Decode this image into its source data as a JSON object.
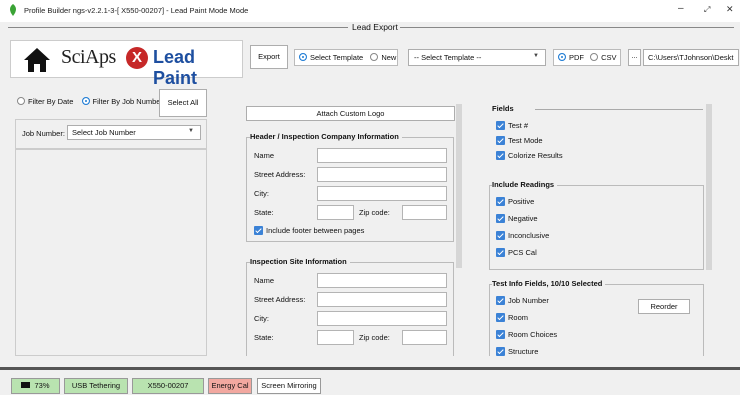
{
  "window": {
    "title": "Profile Builder ngs-v2.2.1-3-[ X550-00207] - Lead Paint Mode Mode",
    "minimize": "–",
    "restore": "⤢",
    "close": "✕"
  },
  "group_title": "Lead Export",
  "brand": {
    "sci": "SciAps",
    "x": "X",
    "product": "Lead Paint"
  },
  "toolbar": {
    "export_label": "Export",
    "select_template_label": "Select Template",
    "new_label": "New",
    "template_dropdown": "-- Select Template --",
    "pdf_label": "PDF",
    "csv_label": "CSV",
    "browse_label": "...",
    "path": "C:\\Users\\TJohnson\\Deskt"
  },
  "left": {
    "filter_by_date": "Filter By Date",
    "filter_by_job": "Filter By Job Number",
    "select_all": "Select All",
    "job_number_label": "Job Number:",
    "job_number_placeholder": "Select Job Number"
  },
  "middle": {
    "attach_logo": "Attach Custom Logo",
    "header_section": "Header / Inspection Company Information",
    "name": "Name",
    "street": "Street Address:",
    "city": "City:",
    "state": "State:",
    "zip": "Zip code:",
    "include_footer": "Include footer between pages",
    "site_section": "Inspection Site Information",
    "site_name": "Name",
    "site_street": "Street Address:",
    "site_city": "City:",
    "site_state": "State:",
    "site_zip": "Zip code:"
  },
  "right": {
    "fields_title": "Fields",
    "fields": [
      "Test #",
      "Test Mode",
      "Colorize Results"
    ],
    "readings_title": "Include Readings",
    "readings": [
      "Positive",
      "Negative",
      "Inconclusive",
      "PCS Cal"
    ],
    "info_title": "Test Info Fields, 10/10 Selected",
    "info_fields": [
      "Job Number",
      "Room",
      "Room Choices",
      "Structure"
    ],
    "reorder_label": "Reorder"
  },
  "status": {
    "battery": "73%",
    "usb": "USB Tethering",
    "device": "X550-00207",
    "energy": "Energy Cal",
    "mirroring": "Screen Mirroring"
  },
  "colors": {
    "accent_blue": "#1e4fa0",
    "checkbox_blue": "#3b82d6",
    "brand_red": "#c62828",
    "green_status": "#b9e3b0",
    "red_status": "#f2a8a0"
  }
}
